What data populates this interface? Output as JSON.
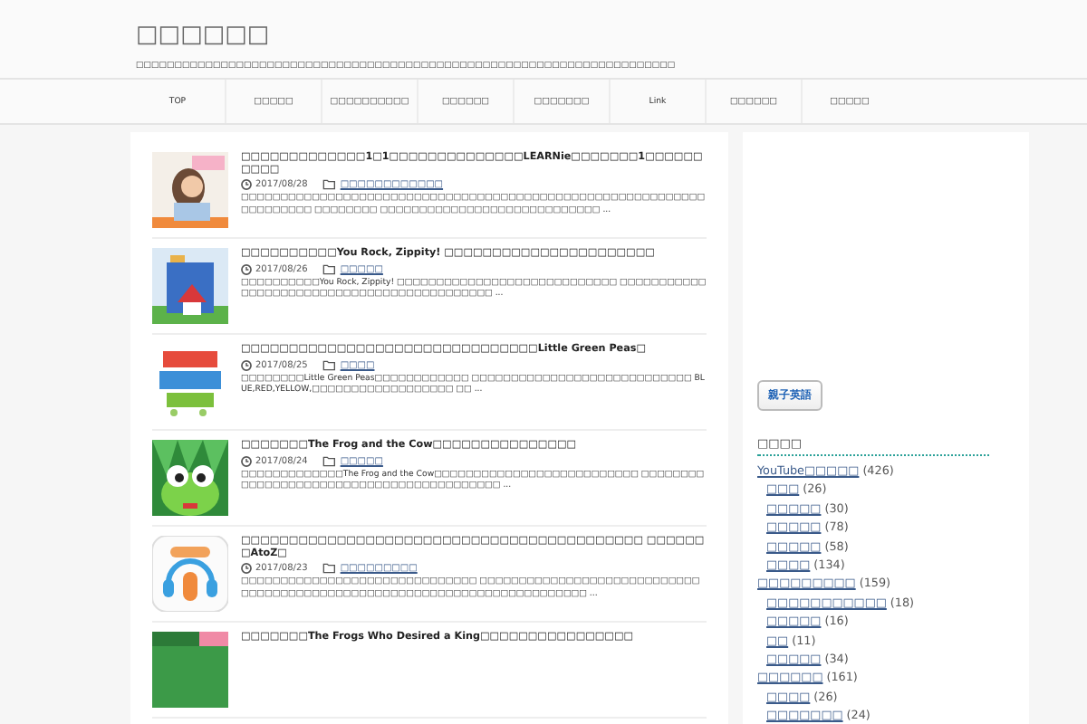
{
  "site": {
    "title": "□□□□□□",
    "tagline": "□□□□□□□□□□□□□□□□□□□□□□□□□□□□□□□□□□□□□□□□□□□□□□□□□□□□□□□□□□□□□□□□□□□□□□"
  },
  "nav": [
    {
      "label": "TOP"
    },
    {
      "label": "□□□□□"
    },
    {
      "label": "□□□□□□□□□□"
    },
    {
      "label": "□□□□□□"
    },
    {
      "label": "□□□□□□□"
    },
    {
      "label": "Link"
    },
    {
      "label": "□□□□□□"
    },
    {
      "label": "□□□□□"
    }
  ],
  "posts": [
    {
      "title": "□□□□□□□□□□□□□1□1□□□□□□□□□□□□□□LEARNie□□□□□□□1□□□□□□□□□□",
      "date": "2017/08/28",
      "category": "□□□□□□□□□□□□",
      "excerpt": "□□□□□□□□□□□□□□□□□□□□□□□□□□□□□□□□□□□□□□□□□□□□□□□□□□□□□□□□□□□□□□□□□□□□ □□□□□□□□ □□□□□□□□□□□□□□□□□□□□□□□□□□□□ ...",
      "kind": "picture"
    },
    {
      "title": "□□□□□□□□□□You Rock, Zippity! □□□□□□□□□□□□□□□□□□□□□□",
      "date": "2017/08/26",
      "category": "□□□□□",
      "excerpt": "□□□□□□□□□□You Rock, Zippity! □□□□□□□□□□□□□□□□□□□□□□□□□□□□ □□□□□□□□□□□□□□□□□□□□□□□□□□□□□□□□□□□□□□□□□□□ ...",
      "kind": "picture"
    },
    {
      "title": "□□□□□□□□□□□□□□□□□□□□□□□□□□□□□□□Little Green Peas□",
      "date": "2017/08/25",
      "category": "□□□□",
      "excerpt": "□□□□□□□□Little Green Peas□□□□□□□□□□□□ □□□□□□□□□□□□□□□□□□□□□□□□□□□□ BLUE,RED,YELLOW,□□□□□□□□□□□□□□□□□□ □□ ...",
      "kind": "picture"
    },
    {
      "title": "□□□□□□□The Frog and the Cow□□□□□□□□□□□□□□□",
      "date": "2017/08/24",
      "category": "□□□□□",
      "excerpt": "□□□□□□□□□□□□□The Frog and the Cow□□□□□□□□□□□□□□□□□□□□□□□□□□ □□□□□□□□□□□□□□□□□□□□□□□□□□□□□□□□□□□□□□□□□ ...",
      "kind": "picture"
    },
    {
      "title": "□□□□□□□□□□□□□□□□□□□□□□□□□□□□□□□□□□□□□□□□□□ □□□□□□□AtoZ□",
      "date": "2017/08/23",
      "category": "□□□□□□□□□",
      "excerpt": "□□□□□□□□□□□□□□□□□□□□□□□□□□□□□□ □□□□□□□□□□□□□□□□□□□□□□□□□□□□□□□□□□□□□□□□□□□□□□□□□□□□□□□□□□□□□□□□□□□□□□□□ ...",
      "kind": "picture"
    },
    {
      "title": "□□□□□□□The Frogs Who Desired a King□□□□□□□□□□□□□□□□",
      "kind": "picture"
    }
  ],
  "sidebar": {
    "banner": "親子英語",
    "heading": "□□□□",
    "categories": [
      {
        "label": "YouTube□□□□□",
        "count": "(426)",
        "children": [
          {
            "label": "□□□",
            "count": "(26)"
          },
          {
            "label": "□□□□□",
            "count": "(30)"
          },
          {
            "label": "□□□□□",
            "count": "(78)"
          },
          {
            "label": "□□□□□",
            "count": "(58)"
          },
          {
            "label": "□□□□",
            "count": "(134)"
          }
        ]
      },
      {
        "label": "□□□□□□□□□",
        "count": "(159)",
        "children": [
          {
            "label": "□□□□□□□□□□□",
            "count": "(18)"
          },
          {
            "label": "□□□□□",
            "count": "(16)"
          },
          {
            "label": "□□",
            "count": "(11)"
          },
          {
            "label": "□□□□□",
            "count": "(34)"
          }
        ]
      },
      {
        "label": "□□□□□□",
        "count": "(161)",
        "children": [
          {
            "label": "□□□□",
            "count": "(26)"
          },
          {
            "label": "□□□□□□□",
            "count": "(24)"
          }
        ]
      }
    ]
  }
}
